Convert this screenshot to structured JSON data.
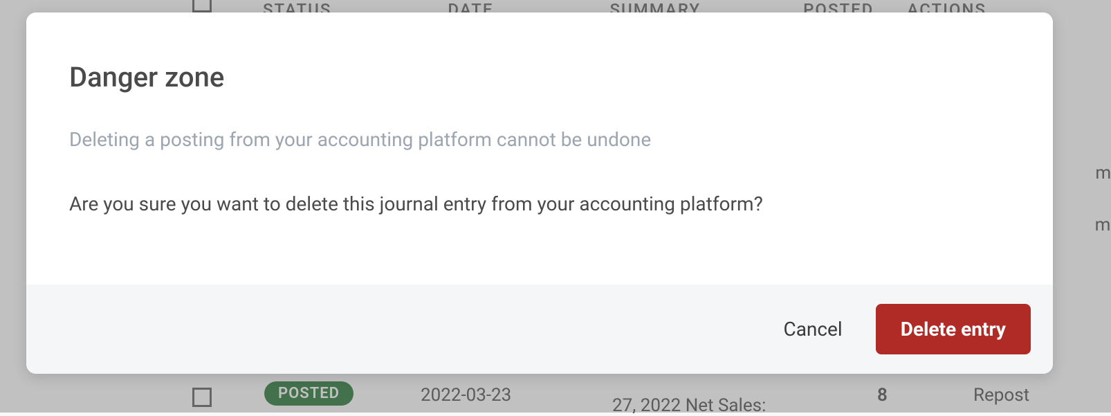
{
  "modal": {
    "title": "Danger zone",
    "subtitle": "Deleting a posting from your accounting platform cannot be undone",
    "message": "Are you sure you want to delete this journal entry from your accounting platform?",
    "cancel_label": "Cancel",
    "delete_label": "Delete entry"
  },
  "background": {
    "headers": {
      "status": "STATUS",
      "date": "DATE",
      "summary": "SUMMARY",
      "posted": "POSTED",
      "actions": "ACTIONS"
    },
    "row": {
      "status_badge": "POSTED",
      "date": "2022-03-23",
      "summary": "27, 2022 Net Sales:",
      "posted_count": "8",
      "action": "Repost"
    },
    "right_text_1": "m s",
    "right_text_2": "m a"
  }
}
